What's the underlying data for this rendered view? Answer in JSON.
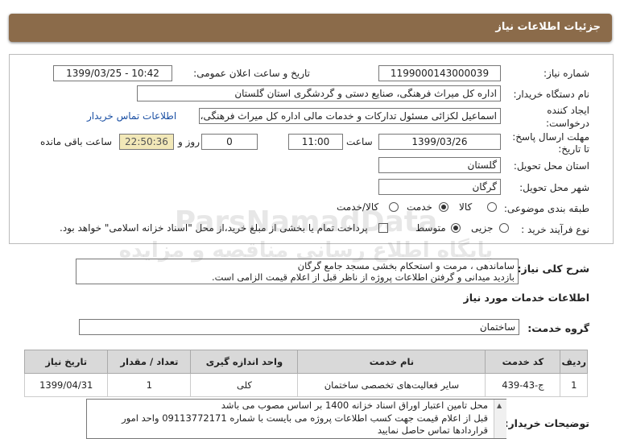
{
  "header": {
    "title": "جزئیات اطلاعات نیاز"
  },
  "form": {
    "need_number_label": "شماره نیاز:",
    "need_number": "1199000143000039",
    "announce_label": "تاریخ و ساعت اعلان عمومی:",
    "announce_value": "1399/03/25 - 10:42",
    "buyer_label": "نام دستگاه خریدار:",
    "buyer_value": "اداره کل میراث فرهنگی، صنایع دستی و گردشگری استان گلستان",
    "creator_label_1": "ایجاد کننده",
    "creator_label_2": "درخواست:",
    "creator_value": "اسماعیل لکزائی مسئول تدارکات و خدمات مالی اداره کل میراث فرهنگی، صنایع",
    "contact_link": "اطلاعات تماس خریدار",
    "deadline_label_1": "مهلت ارسال پاسخ:",
    "deadline_label_2": "تا تاریخ:",
    "deadline_date": "1399/03/26",
    "time_label": "ساعت",
    "deadline_time": "11:00",
    "days_value": "0",
    "days_label": "روز و",
    "remaining_time": "22:50:36",
    "remaining_label": "ساعت باقی مانده",
    "province_label": "استان محل تحویل:",
    "province_value": "گلستان",
    "city_label": "شهر محل تحویل:",
    "city_value": "گرگان",
    "category_label": "طبقه بندی موضوعی:",
    "category_options": [
      "کالا",
      "خدمت",
      "کالا/خدمت"
    ],
    "process_label": "نوع فرآیند خرید :",
    "process_options": [
      "جزیی",
      "متوسط"
    ],
    "payment_note": "پرداخت تمام یا بخشی از مبلغ خرید،از محل \"اسناد خزانه اسلامی\" خواهد بود."
  },
  "description": {
    "label": "شرح کلی نیاز:",
    "line1": "ساماندهی ، مرمت و استحکام بخشی مسجد جامع گرگان",
    "line2": "بازدید میدانی و گرفتن اطلاعات پروژه از ناظر قبل از اعلام قیمت الزامی است."
  },
  "services": {
    "section_title": "اطلاعات خدمات مورد نیاز",
    "group_label": "گروه خدمت:",
    "group_value": "ساختمان",
    "table": {
      "headers": [
        "ردیف",
        "کد خدمت",
        "نام خدمت",
        "واحد اندازه گیری",
        "تعداد / مقدار",
        "تاریخ نیاز"
      ],
      "rows": [
        [
          "1",
          "ج-43-439",
          "سایر فعالیت‌های تخصصی ساختمان",
          "کلی",
          "1",
          "1399/04/31"
        ]
      ]
    }
  },
  "notes": {
    "label": "توضیحات خریدار:",
    "line1": "محل تامین اعتبار اوراق اسناد خزانه 1400 بر اساس مصوب می باشد",
    "line2": "قبل از اعلام قیمت جهت کسب اطلاعات پروژه می بایست با شماره 09113772171 واحد امور",
    "line3": "قراردادها تماس حاصل نمایید"
  },
  "watermark": {
    "line1": "ParsNamadData",
    "line2": "پایگاه اطلاع رسانی مناقصه و مزایده"
  }
}
